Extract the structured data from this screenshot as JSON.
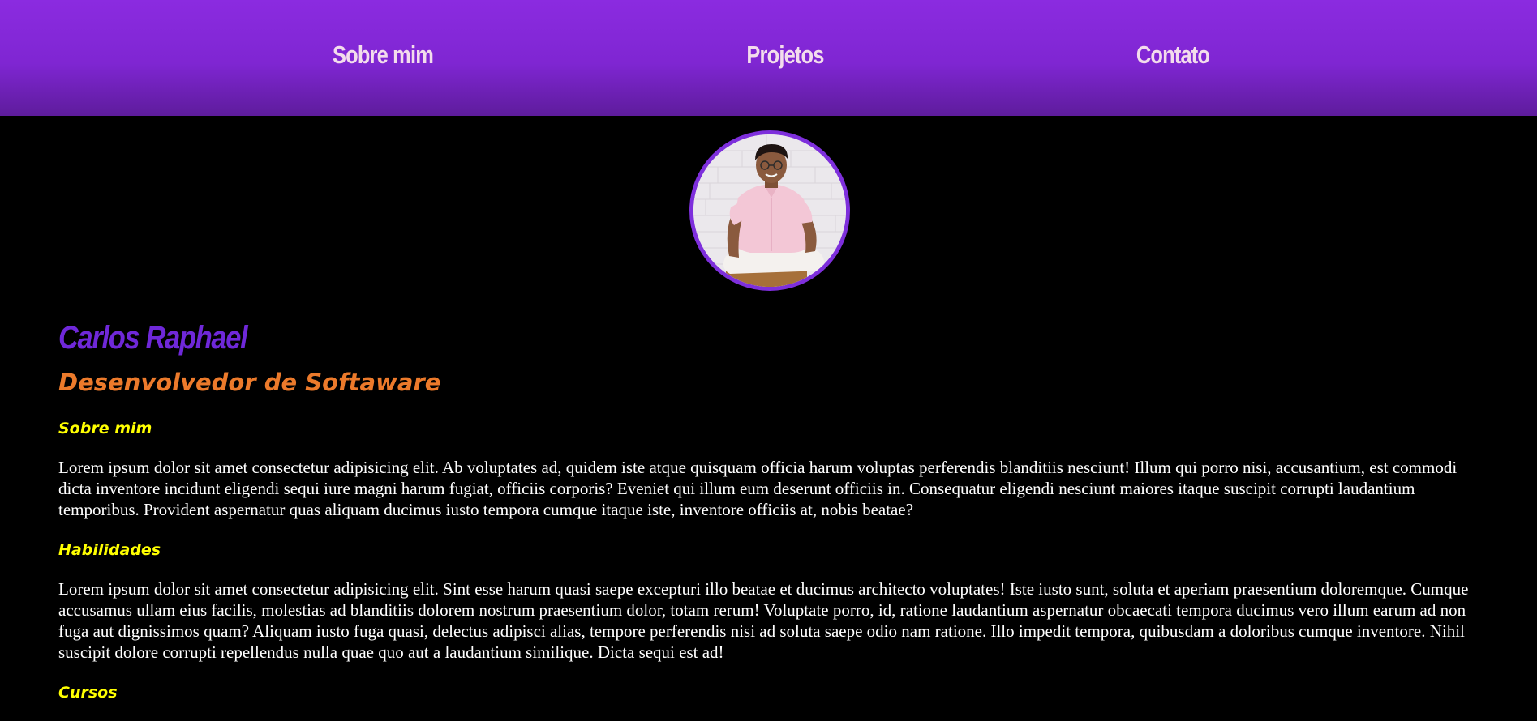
{
  "nav": {
    "items": [
      {
        "label": "Sobre mim"
      },
      {
        "label": "Projetos"
      },
      {
        "label": "Contato"
      }
    ]
  },
  "profile": {
    "name": "Carlos Raphael",
    "role": "Desenvolvedor de Softaware"
  },
  "sections": [
    {
      "title": "Sobre mim",
      "text": "Lorem ipsum dolor sit amet consectetur adipisicing elit. Ab voluptates ad, quidem iste atque quisquam officia harum voluptas perferendis blanditiis nesciunt! Illum qui porro nisi, accusantium, est commodi dicta inventore incidunt eligendi sequi iure magni harum fugiat, officiis corporis? Eveniet qui illum eum deserunt officiis in. Consequatur eligendi nesciunt maiores itaque suscipit corrupti laudantium temporibus. Provident aspernatur quas aliquam ducimus iusto tempora cumque itaque iste, inventore officiis at, nobis beatae?"
    },
    {
      "title": "Habilidades",
      "text": "Lorem ipsum dolor sit amet consectetur adipisicing elit. Sint esse harum quasi saepe excepturi illo beatae et ducimus architecto voluptates! Iste iusto sunt, soluta et aperiam praesentium doloremque. Cumque accusamus ullam eius facilis, molestias ad blanditiis dolorem nostrum praesentium dolor, totam rerum! Voluptate porro, id, ratione laudantium aspernatur obcaecati tempora ducimus vero illum earum ad non fuga aut dignissimos quam? Aliquam iusto fuga quasi, delectus adipisci alias, tempore perferendis nisi ad soluta saepe odio nam ratione. Illo impedit tempora, quibusdam a doloribus cumque inventore. Nihil suscipit dolore corrupti repellendus nulla quae quo aut a laudantium similique. Dicta sequi est ad!"
    },
    {
      "title": "Cursos"
    }
  ],
  "colors": {
    "nav_top": "#8b2be0",
    "nav_bottom": "#5e1c9c",
    "nav_text": "#f3dcec",
    "name": "#6f28d9",
    "role": "#ec7a2b",
    "section_title": "#ffff00",
    "avatar_border": "#7e2fdc"
  }
}
